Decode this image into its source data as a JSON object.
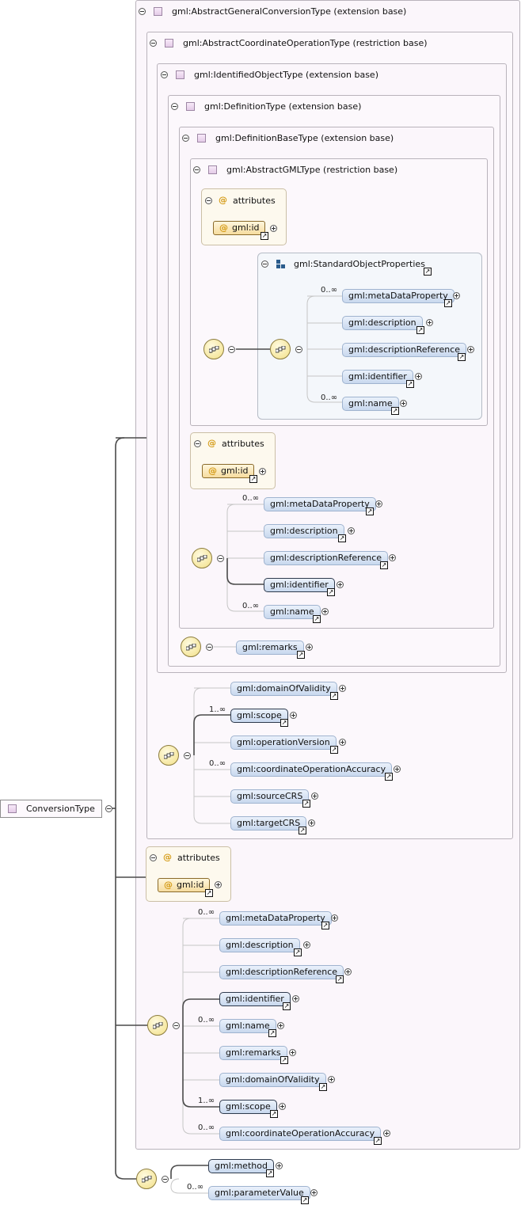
{
  "types": {
    "root": "ConversionType",
    "agc": "gml:AbstractGeneralConversionType (extension base)",
    "aco": "gml:AbstractCoordinateOperationType (restriction base)",
    "io": "gml:IdentifiedObjectType (extension base)",
    "def": "gml:DefinitionType (extension base)",
    "defb": "gml:DefinitionBaseType (extension base)",
    "agml": "gml:AbstractGMLType (restriction base)"
  },
  "group": "gml:StandardObjectProperties",
  "attributes_label": "attributes",
  "attribute_id": "gml:id",
  "cards": {
    "many0": "0..∞",
    "many1": "1..∞"
  },
  "elements": {
    "metaDataProperty": "gml:metaDataProperty",
    "description": "gml:description",
    "descriptionReference": "gml:descriptionReference",
    "identifier": "gml:identifier",
    "name": "gml:name",
    "remarks": "gml:remarks",
    "domainOfValidity": "gml:domainOfValidity",
    "scope": "gml:scope",
    "operationVersion": "gml:operationVersion",
    "coordinateOperationAccuracy": "gml:coordinateOperationAccuracy",
    "sourceCRS": "gml:sourceCRS",
    "targetCRS": "gml:targetCRS",
    "method": "gml:method",
    "parameterValue": "gml:parameterValue"
  },
  "icons": {
    "minus": "collapse-minus-icon",
    "plus": "expand-plus-icon",
    "ref": "reference-arrow-icon",
    "sequence": "sequence-compositor-icon",
    "type": "complex-type-icon",
    "group": "model-group-icon",
    "attribute": "attribute-at-icon"
  }
}
